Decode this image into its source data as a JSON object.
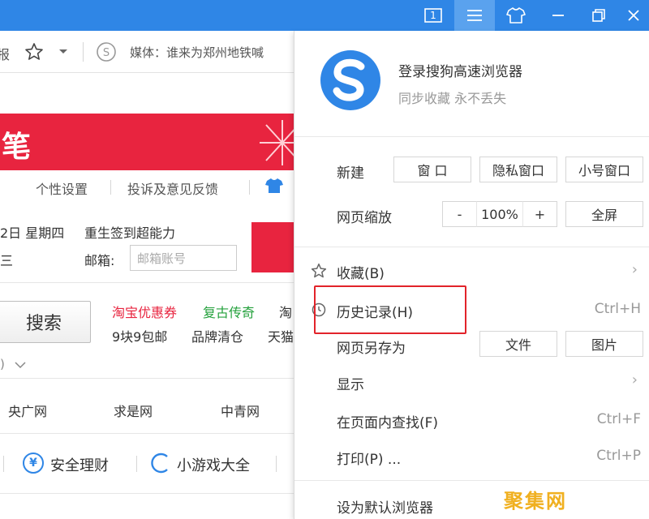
{
  "titlebar": {
    "tab_count": "1",
    "icons": [
      "tab-count-icon",
      "menu-icon",
      "skin-shirt-icon",
      "minimize-icon",
      "restore-icon",
      "close-icon"
    ]
  },
  "page": {
    "addr_text": "媒体：谁来为郑州地铁喊",
    "banner_char": "笔",
    "link_personal": "个性设置",
    "link_feedback": "投诉及意见反馈",
    "date_text": "2日 星期四",
    "promo_text": "重生签到超能力",
    "weekday_tail": "三",
    "email_label": "邮箱:",
    "email_placeholder": "邮箱账号",
    "search_label": "搜索",
    "link_taobao": "淘宝优惠券",
    "link_fugu": "复古传奇",
    "link_tao_tail": "淘",
    "link_9kuai": "9块9包邮",
    "link_brand": "品牌清仓",
    "link_tianmao": "天猫",
    "nav_yangguang": "央广网",
    "nav_qiushi": "求是网",
    "nav_zhongqing": "中青网",
    "bottom_finance": "安全理财",
    "bottom_games": "小游戏大全",
    "finance_icon_glyph": "¥"
  },
  "menu": {
    "login_title": "登录搜狗高速浏览器",
    "login_sub": "同步收藏 永不丢失",
    "new_label": "新建",
    "new_window": "窗 口",
    "new_private": "隐私窗口",
    "new_small": "小号窗口",
    "zoom_label": "网页缩放",
    "zoom_minus": "-",
    "zoom_value": "100%",
    "zoom_plus": "+",
    "fullscreen": "全屏",
    "favorites": "收藏(B)",
    "history": "历史记录(H)",
    "history_shortcut": "Ctrl+H",
    "save_as": "网页另存为",
    "save_file": "文件",
    "save_image": "图片",
    "display": "显示",
    "find": "在页面内查找(F)",
    "find_shortcut": "Ctrl+F",
    "print": "打印(P) ...",
    "print_shortcut": "Ctrl+P",
    "default_browser": "设为默认浏览器"
  },
  "watermark": "聚集网",
  "colors": {
    "titlebar": "#2f86e6",
    "banner": "#e8243f",
    "highlight": "#e2232a"
  }
}
